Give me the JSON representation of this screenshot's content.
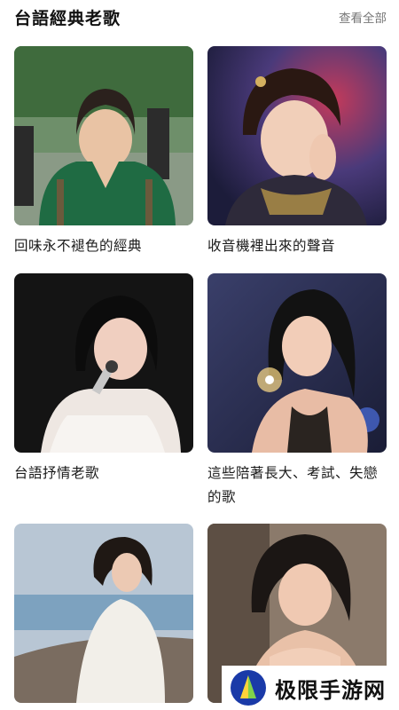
{
  "section": {
    "title": "台語經典老歌",
    "see_all": "查看全部"
  },
  "playlists": [
    {
      "title": "回味永不褪色的經典"
    },
    {
      "title": "收音機裡出來的聲音"
    },
    {
      "title": "台語抒情老歌"
    },
    {
      "title": "這些陪著長大、考試、失戀的歌"
    },
    {
      "title": ""
    },
    {
      "title": ""
    }
  ],
  "watermark": {
    "text": "极限手游网"
  }
}
